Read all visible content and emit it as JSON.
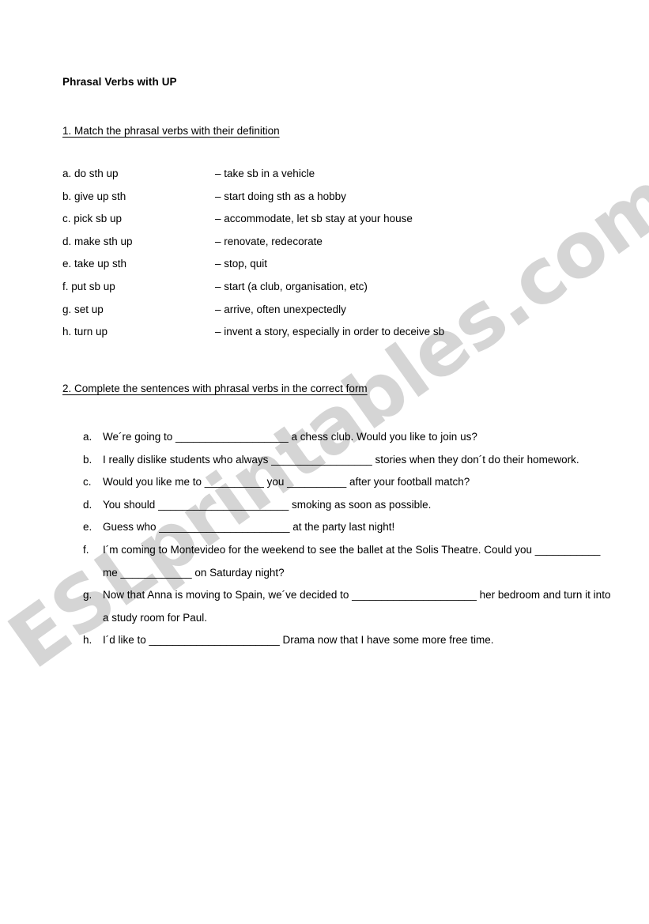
{
  "document": {
    "title": "Phrasal Verbs with UP",
    "watermark": "ESLprintables.com",
    "watermark_color": "#d5d5d5",
    "text_color": "#000000",
    "page_background": "#ffffff"
  },
  "exercise1": {
    "heading": "1. Match the phrasal verbs with their definition",
    "rows": [
      {
        "term": "a. do sth up",
        "definition": "– take sb in a vehicle"
      },
      {
        "term": "b. give up sth",
        "definition": "– start doing sth as a hobby"
      },
      {
        "term": "c. pick sb up",
        "definition": "– accommodate, let sb stay at your house"
      },
      {
        "term": "d. make sth up",
        "definition": "– renovate, redecorate"
      },
      {
        "term": "e. take up sth",
        "definition": "– stop, quit"
      },
      {
        "term": "f.  put sb up",
        "definition": "– start (a club, organisation, etc)"
      },
      {
        "term": "g. set up",
        "definition": "– arrive, often unexpectedly"
      },
      {
        "term": "h. turn up",
        "definition": "– invent a story, especially in order to deceive sb"
      }
    ]
  },
  "exercise2": {
    "heading": "2. Complete the sentences with phrasal verbs in the correct form",
    "items": [
      {
        "marker": "a.",
        "text": "We´re going to ___________________ a chess club. Would you like to join us?"
      },
      {
        "marker": "b.",
        "text": "I really dislike students who always _________________ stories when they don´t do their homework."
      },
      {
        "marker": "c.",
        "text": "Would you like me to __________ you __________ after your football match?"
      },
      {
        "marker": "d.",
        "text": "You should ______________________ smoking as soon as possible."
      },
      {
        "marker": "e.",
        "text": "Guess who ______________________ at the party last night!"
      },
      {
        "marker": "f.",
        "text": "I´m coming to Montevideo for the weekend to see the ballet at the Solis Theatre. Could you ___________ me ____________ on Saturday night?"
      },
      {
        "marker": "g.",
        "text": "Now that Anna is moving to Spain, we´ve decided to _____________________ her bedroom and turn it into a study room for Paul."
      },
      {
        "marker": "h.",
        "text": "I´d like to ______________________ Drama now that I have some more free time."
      }
    ]
  }
}
